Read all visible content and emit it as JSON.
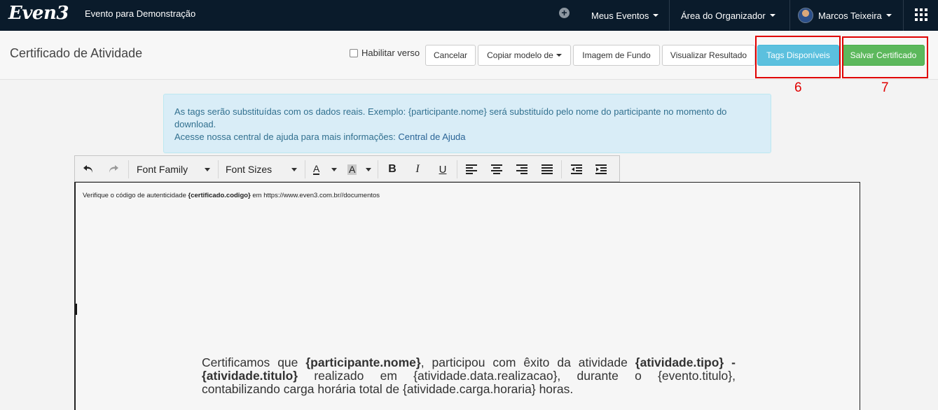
{
  "topbar": {
    "logo": "Even3",
    "event_name": "Evento para Demonstração",
    "add_icon": "plus-circle-icon",
    "menu": [
      {
        "label": "Meus Eventos"
      },
      {
        "label": "Área do Organizador"
      },
      {
        "label": "Marcos Teixeira"
      }
    ],
    "apps_icon": "grid-apps-icon"
  },
  "header": {
    "title": "Certificado de Atividade",
    "checkbox_label": "Habilitar verso",
    "buttons": {
      "cancel": "Cancelar",
      "copy_model": "Copiar modelo de",
      "background": "Imagem de Fundo",
      "preview": "Visualizar Resultado",
      "tags": "Tags Disponíveis",
      "save": "Salvar Certificado"
    },
    "annotations": [
      "6",
      "7"
    ]
  },
  "alert": {
    "line1": "As tags serão substituídas com os dados reais. Exemplo: {participante.nome} será substituído pelo nome do participante no momento do download.",
    "line2_prefix": "Acesse nossa central de ajuda para mais informações: ",
    "link": "Central de Ajuda"
  },
  "toolbar": {
    "font_family": "Font Family",
    "font_sizes": "Font Sizes",
    "text_color_glyph": "A",
    "bg_color_glyph": "A",
    "bold": "B",
    "italic": "I",
    "underline": "U"
  },
  "editor": {
    "verify_prefix": "Verifique o código de autenticidade ",
    "verify_tag": "{certificado.codigo}",
    "verify_suffix": " em https://www.even3.com.br//documentos",
    "cert": {
      "p1": "Certificamos que ",
      "b1": "{participante.nome}",
      "p2": ", participou com êxito da atividade ",
      "b2": "{atividade.tipo} - {atividade.titulo}",
      "p3": " realizado em {atividade.data.realizacao}, durante o {evento.titulo}, contabilizando carga horária total de {atividade.carga.horaria} horas."
    }
  }
}
